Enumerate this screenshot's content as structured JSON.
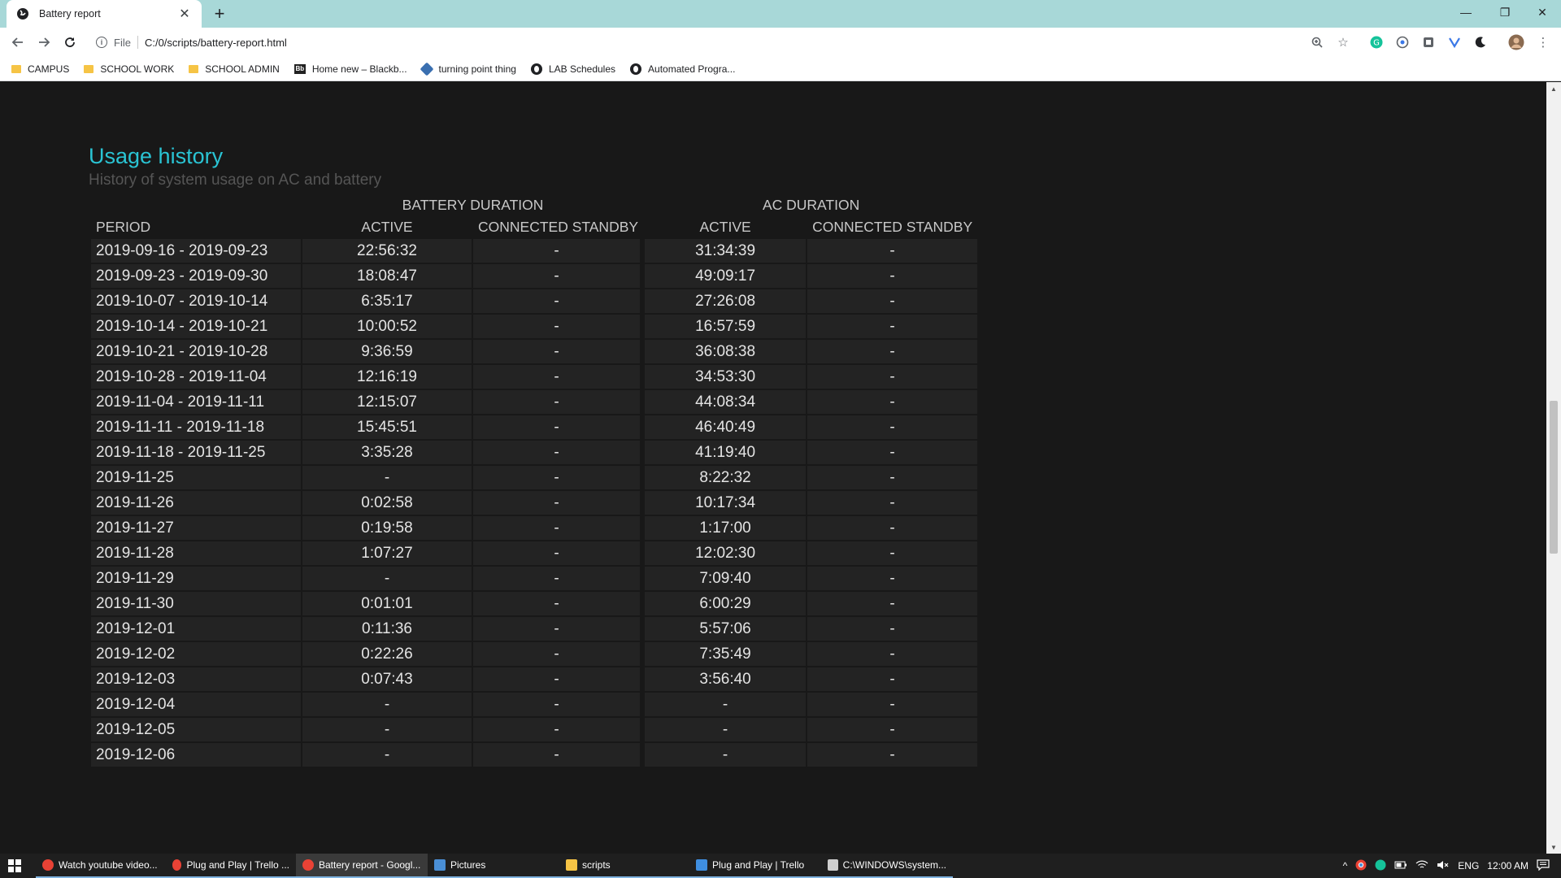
{
  "browser": {
    "tab_title": "Battery report",
    "tab_close": "✕",
    "new_tab": "+",
    "window": {
      "minimize": "—",
      "restore": "❐",
      "close": "✕"
    },
    "address_scheme": "File",
    "address_url": "C:/0/scripts/battery-report.html",
    "bookmarks": [
      {
        "label": "CAMPUS",
        "icon": "folder-icon"
      },
      {
        "label": "SCHOOL WORK",
        "icon": "folder-icon"
      },
      {
        "label": "SCHOOL ADMIN",
        "icon": "folder-icon"
      },
      {
        "label": "Home new – Blackb...",
        "icon": "blackboard-icon"
      },
      {
        "label": "turning point thing",
        "icon": "cube-icon"
      },
      {
        "label": "LAB Schedules",
        "icon": "globe-icon"
      },
      {
        "label": "Automated Progra...",
        "icon": "globe-icon"
      }
    ]
  },
  "report": {
    "title": "Usage history",
    "subtitle": "History of system usage on AC and battery",
    "group_battery": "BATTERY DURATION",
    "group_ac": "AC DURATION",
    "col_period": "PERIOD",
    "col_active": "ACTIVE",
    "col_connected_standby": "CONNECTED STANDBY",
    "rows": [
      [
        "2019-09-16 - 2019-09-23",
        "22:56:32",
        "-",
        "31:34:39",
        "-"
      ],
      [
        "2019-09-23 - 2019-09-30",
        "18:08:47",
        "-",
        "49:09:17",
        "-"
      ],
      [
        "2019-10-07 - 2019-10-14",
        "6:35:17",
        "-",
        "27:26:08",
        "-"
      ],
      [
        "2019-10-14 - 2019-10-21",
        "10:00:52",
        "-",
        "16:57:59",
        "-"
      ],
      [
        "2019-10-21 - 2019-10-28",
        "9:36:59",
        "-",
        "36:08:38",
        "-"
      ],
      [
        "2019-10-28 - 2019-11-04",
        "12:16:19",
        "-",
        "34:53:30",
        "-"
      ],
      [
        "2019-11-04 - 2019-11-11",
        "12:15:07",
        "-",
        "44:08:34",
        "-"
      ],
      [
        "2019-11-11 - 2019-11-18",
        "15:45:51",
        "-",
        "46:40:49",
        "-"
      ],
      [
        "2019-11-18 - 2019-11-25",
        "3:35:28",
        "-",
        "41:19:40",
        "-"
      ],
      [
        "2019-11-25",
        "-",
        "-",
        "8:22:32",
        "-"
      ],
      [
        "2019-11-26",
        "0:02:58",
        "-",
        "10:17:34",
        "-"
      ],
      [
        "2019-11-27",
        "0:19:58",
        "-",
        "1:17:00",
        "-"
      ],
      [
        "2019-11-28",
        "1:07:27",
        "-",
        "12:02:30",
        "-"
      ],
      [
        "2019-11-29",
        "-",
        "-",
        "7:09:40",
        "-"
      ],
      [
        "2019-11-30",
        "0:01:01",
        "-",
        "6:00:29",
        "-"
      ],
      [
        "2019-12-01",
        "0:11:36",
        "-",
        "5:57:06",
        "-"
      ],
      [
        "2019-12-02",
        "0:22:26",
        "-",
        "7:35:49",
        "-"
      ],
      [
        "2019-12-03",
        "0:07:43",
        "-",
        "3:56:40",
        "-"
      ],
      [
        "2019-12-04",
        "-",
        "-",
        "-",
        "-"
      ],
      [
        "2019-12-05",
        "-",
        "-",
        "-",
        "-"
      ],
      [
        "2019-12-06",
        "-",
        "-",
        "-",
        "-"
      ]
    ]
  },
  "taskbar": {
    "items": [
      {
        "label": "Watch youtube video...",
        "icon": "chrome-icon",
        "color": "#e94235",
        "active": false
      },
      {
        "label": "Plug and Play | Trello ...",
        "icon": "chrome-icon",
        "color": "#e94235",
        "active": false
      },
      {
        "label": "Battery report - Googl...",
        "icon": "chrome-icon",
        "color": "#e94235",
        "active": true
      },
      {
        "label": "Pictures",
        "icon": "photos-icon",
        "color": "#4a8fd6",
        "active": false
      },
      {
        "label": "scripts",
        "icon": "folder-icon",
        "color": "#f6c445",
        "active": false
      },
      {
        "label": "Plug and Play | Trello",
        "icon": "trello-icon",
        "color": "#3f8ee0",
        "active": false
      },
      {
        "label": "C:\\WINDOWS\\system...",
        "icon": "cmd-icon",
        "color": "#cfcfcf",
        "active": false
      }
    ],
    "language": "ENG",
    "clock": "12:00 AM"
  },
  "colors": {
    "accent_title": "#2ac4d4",
    "page_bg": "#181818",
    "cell_bg": "#232323",
    "tab_strip": "#a8d8d8"
  }
}
